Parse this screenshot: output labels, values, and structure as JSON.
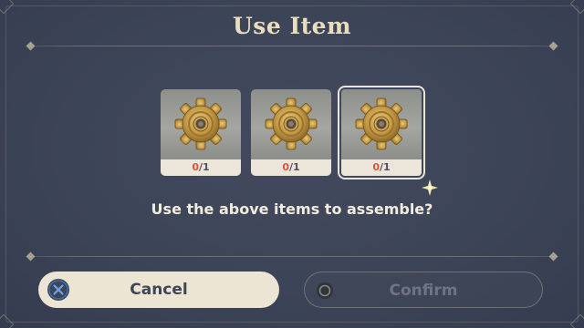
{
  "dialog": {
    "title": "Use Item",
    "prompt": "Use the above items to assemble?"
  },
  "items": [
    {
      "icon": "gear-icon",
      "have": "0",
      "need": "/1",
      "selected": false
    },
    {
      "icon": "gear-icon",
      "have": "0",
      "need": "/1",
      "selected": false
    },
    {
      "icon": "gear-icon",
      "have": "0",
      "need": "/1",
      "selected": true
    }
  ],
  "buttons": {
    "cancel_label": "Cancel",
    "cancel_icon": "cross-button-icon",
    "confirm_label": "Confirm",
    "confirm_icon": "circle-button-icon"
  },
  "colors": {
    "background": "#3a4256",
    "title": "#e9dcc0",
    "count_have": "#e0523e",
    "cancel_bg": "#ede5d3",
    "cross_button": "#3b74c8"
  }
}
